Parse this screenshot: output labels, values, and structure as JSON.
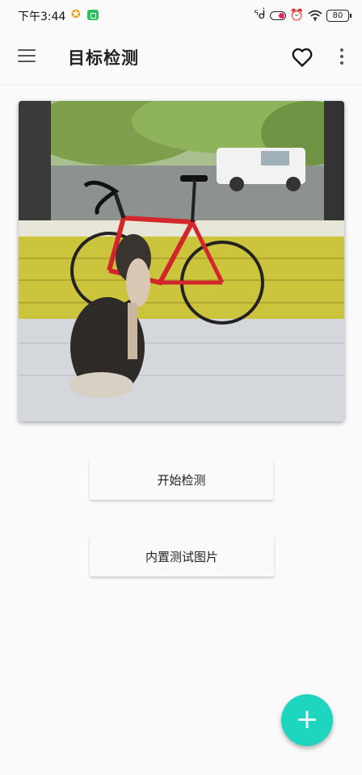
{
  "status_bar": {
    "time": "下午3:44",
    "battery": "80",
    "icons": [
      "notification-star-icon",
      "meeting-app-icon",
      "bluetooth-icon",
      "toggle-icon",
      "alarm-icon",
      "wifi-icon",
      "battery-icon"
    ]
  },
  "app_bar": {
    "title": "目标检测",
    "menu_icon": "menu-icon",
    "favorite_icon": "heart-icon",
    "more_icon": "more-vert-icon"
  },
  "preview": {
    "description_icon": "photo-preview"
  },
  "actions": {
    "start_detect_label": "开始检测",
    "builtin_images_label": "内置测试图片"
  },
  "fab": {
    "label": "+",
    "color": "#1ed5c0"
  }
}
